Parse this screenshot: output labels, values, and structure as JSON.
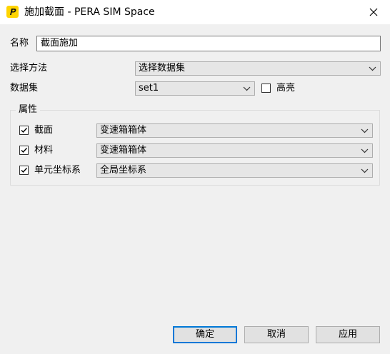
{
  "window": {
    "title": "施加截面 - PERA SIM Space",
    "close_icon": "close-icon",
    "app_icon": "pera-logo-icon"
  },
  "form": {
    "name_label": "名称",
    "name_value": "截面施加",
    "method_label": "选择方法",
    "method_value": "选择数据集",
    "dataset_label": "数据集",
    "dataset_value": "set1",
    "highlight_label": "高亮",
    "highlight_checked": false
  },
  "attributes": {
    "title": "属性",
    "rows": [
      {
        "label": "截面",
        "checked": true,
        "value": "变速箱箱体"
      },
      {
        "label": "材料",
        "checked": true,
        "value": "变速箱箱体"
      },
      {
        "label": "单元坐标系",
        "checked": true,
        "value": "全局坐标系"
      }
    ]
  },
  "buttons": {
    "ok": "确定",
    "cancel": "取消",
    "apply": "应用"
  },
  "colors": {
    "accent": "#0078d7",
    "icon_yellow": "#ffd400"
  }
}
